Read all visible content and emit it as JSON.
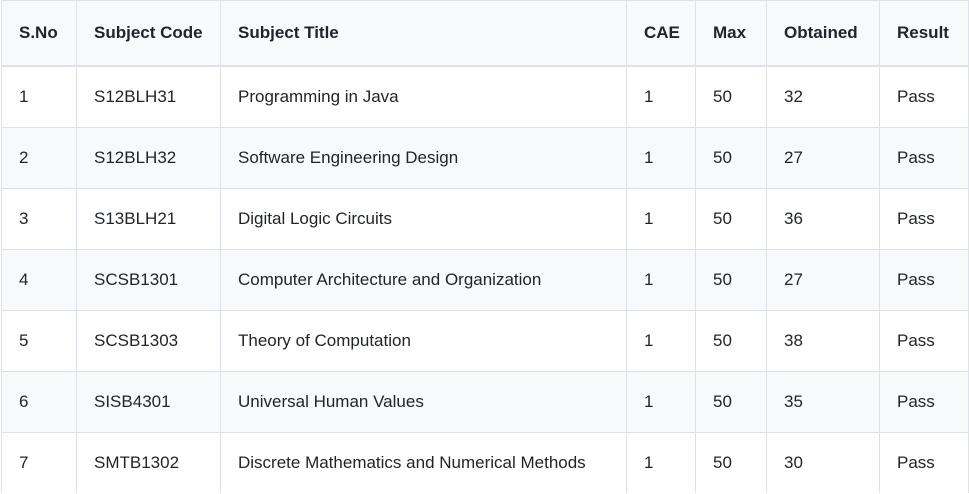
{
  "table": {
    "headers": [
      "S.No",
      "Subject Code",
      "Subject Title",
      "CAE",
      "Max",
      "Obtained",
      "Result"
    ],
    "rows": [
      [
        "1",
        "S12BLH31",
        "Programming in Java",
        "1",
        "50",
        "32",
        "Pass"
      ],
      [
        "2",
        "S12BLH32",
        "Software Engineering Design",
        "1",
        "50",
        "27",
        "Pass"
      ],
      [
        "3",
        "S13BLH21",
        "Digital Logic Circuits",
        "1",
        "50",
        "36",
        "Pass"
      ],
      [
        "4",
        "SCSB1301",
        "Computer Architecture and Organization",
        "1",
        "50",
        "27",
        "Pass"
      ],
      [
        "5",
        "SCSB1303",
        "Theory of Computation",
        "1",
        "50",
        "38",
        "Pass"
      ],
      [
        "6",
        "SISB4301",
        "Universal Human Values",
        "1",
        "50",
        "35",
        "Pass"
      ],
      [
        "7",
        "SMTB1302",
        "Discrete Mathematics and Numerical Methods",
        "1",
        "50",
        "30",
        "Pass"
      ]
    ]
  }
}
